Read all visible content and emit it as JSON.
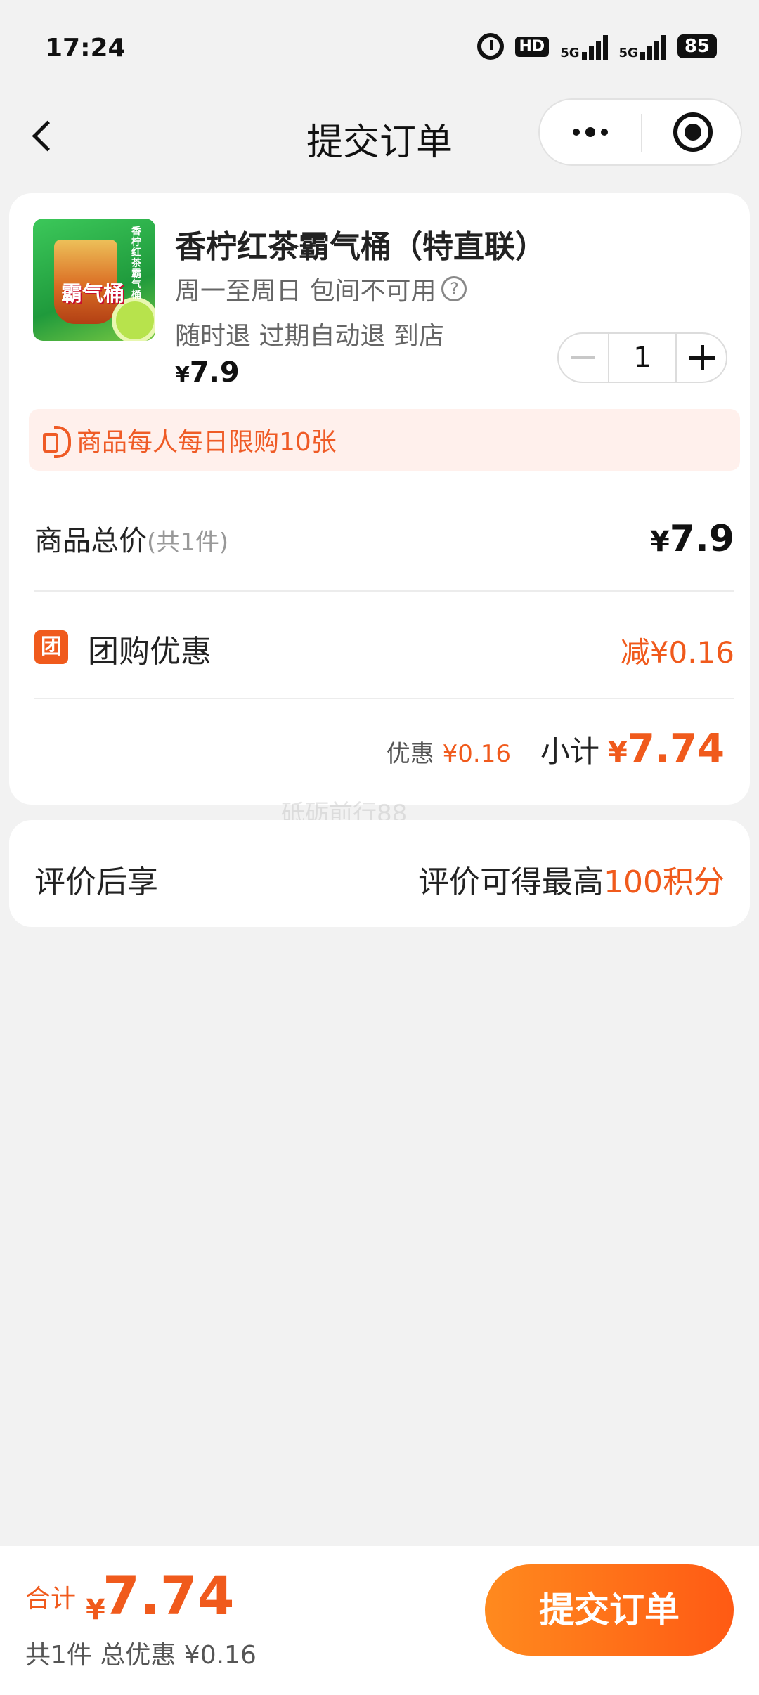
{
  "status_bar": {
    "time": "17:24",
    "hd_label": "HD",
    "network_1": "5G",
    "network_2": "5G",
    "battery": "85"
  },
  "nav": {
    "title": "提交订单",
    "more_icon": "more-dots-icon",
    "target_icon": "target-icon"
  },
  "product": {
    "thumb_text": "霸气桶",
    "thumb_side_text": "香柠红茶霸气桶",
    "name": "香柠红茶霸气桶（特直联）",
    "rule": "周一至周日 包间不可用",
    "policy": "随时退 过期自动退 到店",
    "price_symbol": "¥",
    "price": "7.9",
    "quantity": "1"
  },
  "limit_notice": "商品每人每日限购10张",
  "summary": {
    "total_label": "商品总价",
    "total_count": "(共1件)",
    "total_symbol": "¥",
    "total_price": "7.9",
    "group_icon_text": "团",
    "group_label": "团购优惠",
    "group_value": "减¥0.16",
    "discount_label": "优惠",
    "discount_value": "¥0.16",
    "subtotal_label": "小计",
    "subtotal_symbol": "¥",
    "subtotal_value": "7.74"
  },
  "watermark": "砥砺前行88",
  "review": {
    "label": "评价后享",
    "value_prefix": "评价可得最高",
    "value_accent": "100积分"
  },
  "bottom": {
    "total_label": "合计",
    "total_symbol": "¥",
    "total_value": "7.74",
    "summary": "共1件 总优惠 ¥0.16",
    "submit_label": "提交订单"
  },
  "colors": {
    "accent": "#f05a1c",
    "button_start": "#ff8a1e",
    "button_end": "#ff5a14",
    "notice_bg": "#fff0ec"
  }
}
